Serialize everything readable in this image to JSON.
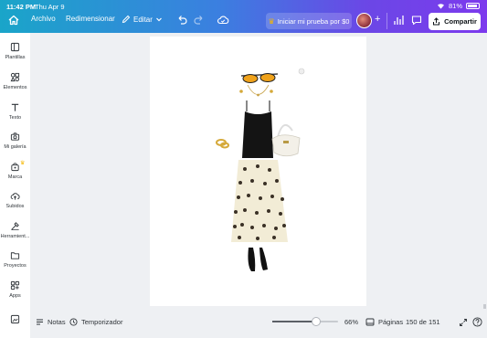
{
  "status_bar": {
    "time": "11:42 PM",
    "date": "Thu Apr 9",
    "battery": "81%"
  },
  "toolbar": {
    "archivo": "Archivo",
    "redimensionar": "Redimensionar",
    "editar": "Editar",
    "trial": "Iniciar mi prueba por $0",
    "share": "Compartir"
  },
  "sidebar": {
    "items": [
      {
        "label": "Plantillas",
        "icon": "templates-icon"
      },
      {
        "label": "Elementos",
        "icon": "elements-icon"
      },
      {
        "label": "Texto",
        "icon": "text-icon"
      },
      {
        "label": "Mi galería",
        "icon": "camera-icon"
      },
      {
        "label": "Marca",
        "icon": "brand-icon"
      },
      {
        "label": "Subidos",
        "icon": "upload-cloud-icon"
      },
      {
        "label": "Herramient...",
        "icon": "tools-icon"
      },
      {
        "label": "Proyectos",
        "icon": "folder-icon"
      },
      {
        "label": "Apps",
        "icon": "apps-icon"
      }
    ]
  },
  "bottombar": {
    "notes": "Notas",
    "timer": "Temporizador",
    "zoom": "66%",
    "zoom_level": 0.66,
    "pages": "Páginas",
    "page_count": "150 de 151"
  },
  "colors": {
    "accent_start": "#1aa5c9",
    "accent_end": "#7c3aed",
    "brand_crown": "#f5b700"
  }
}
